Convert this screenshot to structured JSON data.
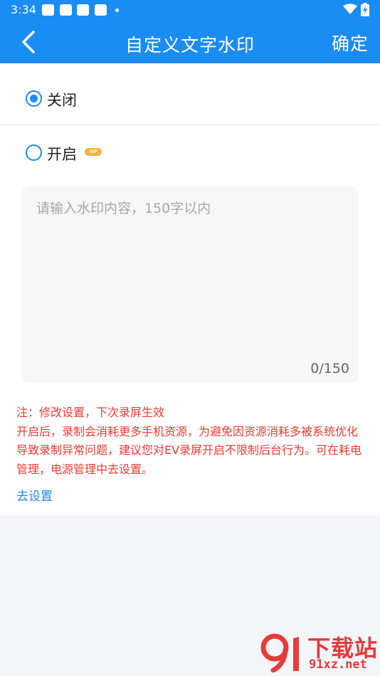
{
  "status_bar": {
    "time": "3:34",
    "icons": [
      "notification-icon",
      "notification-icon",
      "notification-icon",
      "notification-icon",
      "dot-icon",
      "wifi-icon",
      "battery-charging-icon"
    ]
  },
  "app_bar": {
    "title": "自定义文字水印",
    "confirm_label": "确定"
  },
  "options": {
    "off_label": "关闭",
    "on_label": "开启",
    "vip_badge": "VIP",
    "selected": "off"
  },
  "input": {
    "value": "",
    "placeholder": "请输入水印内容，150字以内",
    "char_count": "0/150"
  },
  "notes": {
    "line1": "注：修改设置，下次录屏生效",
    "line2": "开启后，录制会消耗更多手机资源，为避免因资源消耗多被系统优化导致录制异常问题，建议您对EV录屏开启不限制后台行为。可在耗电管理，电源管理中去设置。"
  },
  "settings_link": "去设置",
  "watermark": {
    "text": "下载站",
    "url": "91xz.net"
  },
  "colors": {
    "accent": "#1a8cf5",
    "warning": "#ef3a32",
    "vip": "#f6b046",
    "watermark": "#e63b3b"
  }
}
